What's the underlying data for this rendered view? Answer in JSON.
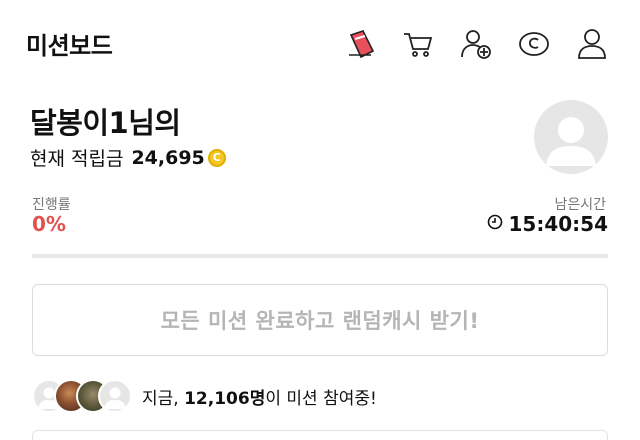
{
  "header": {
    "title": "미션보드",
    "icons": [
      "ticket-icon",
      "cart-icon",
      "add-friend-icon",
      "cash-coin-icon",
      "profile-icon"
    ]
  },
  "profile": {
    "nickname": "달봉이1님의",
    "points_label": "현재 적립금",
    "points_value": "24,695",
    "coin_symbol": "C"
  },
  "stats": {
    "progress_label": "진행률",
    "progress_value": "0%",
    "remain_label": "남은시간",
    "remain_value": "15:40:54"
  },
  "claim_button_label": "모든 미션 완료하고 랜덤캐시 받기!",
  "participants": {
    "prefix": "지금, ",
    "count": "12,106명",
    "suffix": "이 미션 참여중!"
  },
  "colors": {
    "progress": "#e0524f",
    "coin": "#f3c623",
    "ticket_accent": "#e8505b"
  }
}
